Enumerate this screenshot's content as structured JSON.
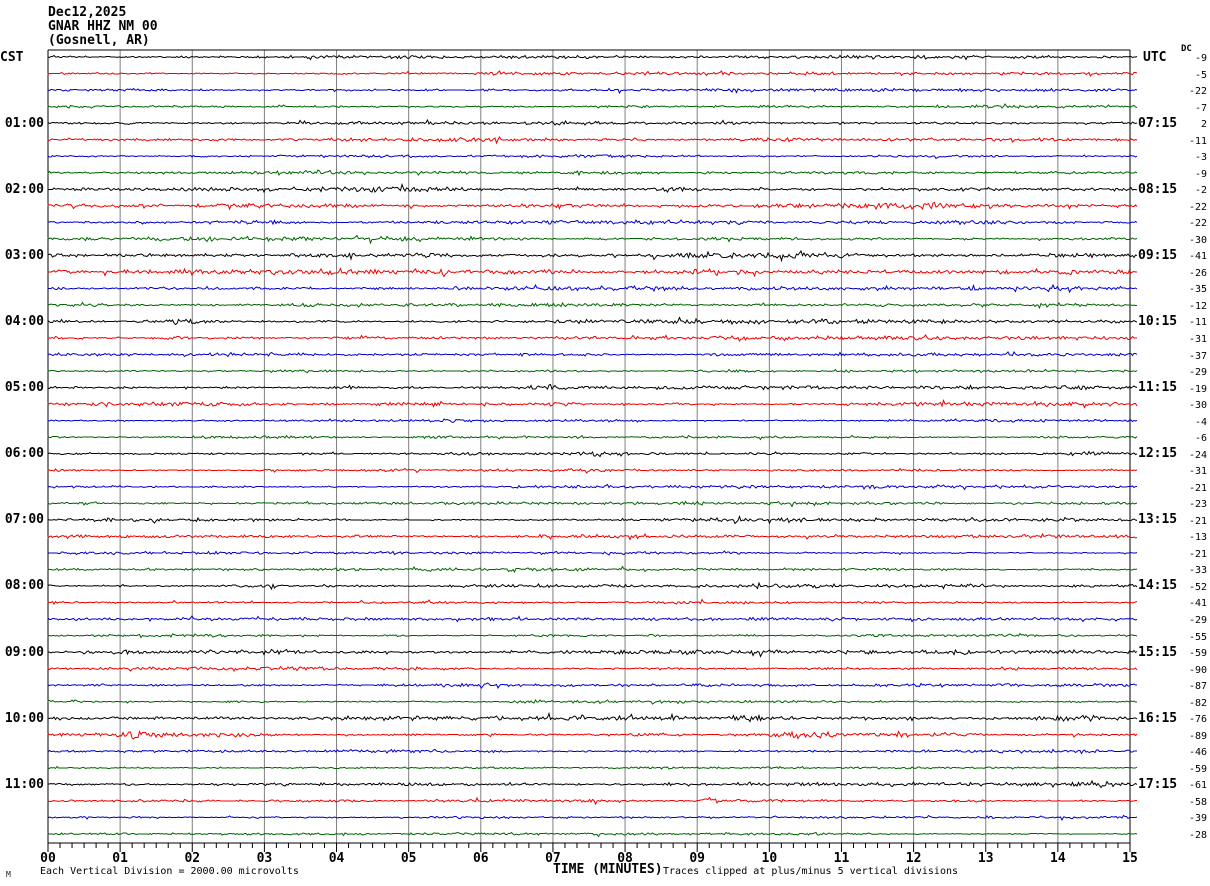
{
  "header": {
    "date": "Dec12,2025",
    "station": "GNAR HHZ NM 00",
    "location": "(Gosnell, AR)"
  },
  "axes": {
    "left_title": "CST",
    "right_title": "UTC",
    "dc_label": "DC",
    "x_axis_title": "TIME (MINUTES)",
    "x_tick_labels": [
      "00",
      "01",
      "02",
      "03",
      "04",
      "05",
      "06",
      "07",
      "08",
      "09",
      "10",
      "11",
      "12",
      "13",
      "14",
      "15"
    ]
  },
  "footer": {
    "watermark": "M",
    "scale_note": "Each Vertical Division = 2000.00 microvolts",
    "clip_note": "Traces clipped at plus/minus 5 vertical divisions"
  },
  "chart_data": {
    "type": "line",
    "subtype": "helicorder-seismogram",
    "title": "GNAR HHZ NM 00 (Gosnell, AR) Dec12,2025",
    "xlabel": "TIME (MINUTES)",
    "x_range": [
      0,
      15
    ],
    "minutes_per_line": 15,
    "lines_per_hour": 4,
    "grid": "vertical gray line at each minute",
    "legend_position": "none",
    "trace_colors": {
      "black": "#000000",
      "red": "#ee0000",
      "blue": "#0000cc",
      "green": "#006600"
    },
    "scale_note": "Each Vertical Division = 2000.00 microvolts",
    "clip_note": "Traces clipped at plus/minus 5 vertical divisions",
    "rows": [
      {
        "color": "black",
        "dc": -9,
        "amp": 1.1
      },
      {
        "color": "red",
        "dc": -5,
        "amp": 1.2
      },
      {
        "color": "blue",
        "dc": -22,
        "amp": 1.2
      },
      {
        "color": "green",
        "dc": -7,
        "amp": 1.1
      },
      {
        "color": "black",
        "dc": 2,
        "amp": 1.1,
        "cst": "01:00",
        "utc": "07:15"
      },
      {
        "color": "red",
        "dc": -11,
        "amp": 1.3
      },
      {
        "color": "blue",
        "dc": -3,
        "amp": 1.1
      },
      {
        "color": "green",
        "dc": -9,
        "amp": 1.1
      },
      {
        "color": "black",
        "dc": -2,
        "amp": 2.0,
        "cst": "02:00",
        "utc": "08:15"
      },
      {
        "color": "red",
        "dc": -22,
        "amp": 1.6,
        "events": [
          {
            "t": 12.0,
            "w": 0.45,
            "a": 2.8
          },
          {
            "t": 2.5,
            "w": 0.8,
            "a": 1.2
          }
        ]
      },
      {
        "color": "blue",
        "dc": -22,
        "amp": 1.4,
        "events": [
          {
            "t": 3.0,
            "w": 0.5,
            "a": 1.5
          }
        ]
      },
      {
        "color": "green",
        "dc": -30,
        "amp": 1.4,
        "events": [
          {
            "t": 3.2,
            "w": 0.4,
            "a": 1.5
          }
        ]
      },
      {
        "color": "black",
        "dc": -41,
        "amp": 2.4,
        "cst": "03:00",
        "utc": "09:15"
      },
      {
        "color": "red",
        "dc": -26,
        "amp": 1.9,
        "events": [
          {
            "t": 3.9,
            "w": 0.06,
            "a": 4,
            "dir": 1
          }
        ]
      },
      {
        "color": "blue",
        "dc": -35,
        "amp": 1.4,
        "events": [
          {
            "t": 8.3,
            "w": 0.4,
            "a": 1.5
          }
        ]
      },
      {
        "color": "green",
        "dc": -12,
        "amp": 1.4,
        "events": [
          {
            "t": 3.5,
            "w": 0.3,
            "a": 1.8
          },
          {
            "t": 14.2,
            "w": 0.3,
            "a": 1.8
          }
        ]
      },
      {
        "color": "black",
        "dc": -11,
        "amp": 1.6,
        "cst": "04:00",
        "utc": "10:15",
        "events": [
          {
            "t": 1.9,
            "w": 0.35,
            "a": 2.2
          }
        ]
      },
      {
        "color": "red",
        "dc": -31,
        "amp": 1.3,
        "events": [
          {
            "t": 1.8,
            "w": 0.3,
            "a": 1.5
          },
          {
            "t": 9.5,
            "w": 0.3,
            "a": 1.5
          }
        ]
      },
      {
        "color": "blue",
        "dc": -37,
        "amp": 1.2
      },
      {
        "color": "green",
        "dc": -29,
        "amp": 1.2
      },
      {
        "color": "black",
        "dc": -19,
        "amp": 1.4,
        "cst": "05:00",
        "utc": "11:15",
        "events": [
          {
            "t": 6.9,
            "w": 0.25,
            "a": 1.8
          },
          {
            "t": 9.9,
            "w": 0.25,
            "a": 1.5
          }
        ]
      },
      {
        "color": "red",
        "dc": -30,
        "amp": 1.3
      },
      {
        "color": "blue",
        "dc": -4,
        "amp": 0.95
      },
      {
        "color": "green",
        "dc": -6,
        "amp": 0.95,
        "events": [
          {
            "t": 5.4,
            "w": 0.25,
            "a": 1.5
          }
        ]
      },
      {
        "color": "black",
        "dc": -24,
        "amp": 1.2,
        "cst": "06:00",
        "utc": "12:15",
        "events": [
          {
            "t": 7.6,
            "w": 0.12,
            "a": 2.5
          }
        ]
      },
      {
        "color": "red",
        "dc": -31,
        "amp": 1.1
      },
      {
        "color": "blue",
        "dc": -21,
        "amp": 1.0
      },
      {
        "color": "green",
        "dc": -23,
        "amp": 1.0
      },
      {
        "color": "black",
        "dc": -21,
        "amp": 1.2,
        "cst": "07:00",
        "utc": "13:15"
      },
      {
        "color": "red",
        "dc": -13,
        "amp": 1.1
      },
      {
        "color": "blue",
        "dc": -21,
        "amp": 1.0
      },
      {
        "color": "green",
        "dc": -33,
        "amp": 1.0
      },
      {
        "color": "black",
        "dc": -52,
        "amp": 1.3,
        "cst": "08:00",
        "utc": "14:15"
      },
      {
        "color": "red",
        "dc": -41,
        "amp": 1.1
      },
      {
        "color": "blue",
        "dc": -29,
        "amp": 1.0
      },
      {
        "color": "green",
        "dc": -55,
        "amp": 1.0
      },
      {
        "color": "black",
        "dc": -59,
        "amp": 1.5,
        "cst": "09:00",
        "utc": "15:15"
      },
      {
        "color": "red",
        "dc": -90,
        "amp": 1.2
      },
      {
        "color": "blue",
        "dc": -87,
        "amp": 1.1
      },
      {
        "color": "green",
        "dc": -82,
        "amp": 1.1
      },
      {
        "color": "black",
        "dc": -76,
        "amp": 1.7,
        "cst": "10:00",
        "utc": "16:15",
        "events": [
          {
            "t": 9.7,
            "w": 0.25,
            "a": 2.0
          },
          {
            "t": 14.15,
            "w": 0.45,
            "a": 2.5
          }
        ]
      },
      {
        "color": "red",
        "dc": -89,
        "amp": 1.4,
        "events": [
          {
            "t": 1.25,
            "w": 0.28,
            "a": 4.2
          },
          {
            "t": 10.45,
            "w": 0.4,
            "a": 3.2
          }
        ]
      },
      {
        "color": "blue",
        "dc": -46,
        "amp": 1.1
      },
      {
        "color": "green",
        "dc": -59,
        "amp": 0.95
      },
      {
        "color": "black",
        "dc": -61,
        "amp": 1.3,
        "cst": "11:00",
        "utc": "17:15"
      },
      {
        "color": "red",
        "dc": -58,
        "amp": 1.1,
        "events": [
          {
            "t": 9.15,
            "w": 0.045,
            "a": 6,
            "dir": -1
          }
        ]
      },
      {
        "color": "blue",
        "dc": -39,
        "amp": 0.95
      },
      {
        "color": "green",
        "dc": -28,
        "amp": 0.9
      }
    ]
  }
}
